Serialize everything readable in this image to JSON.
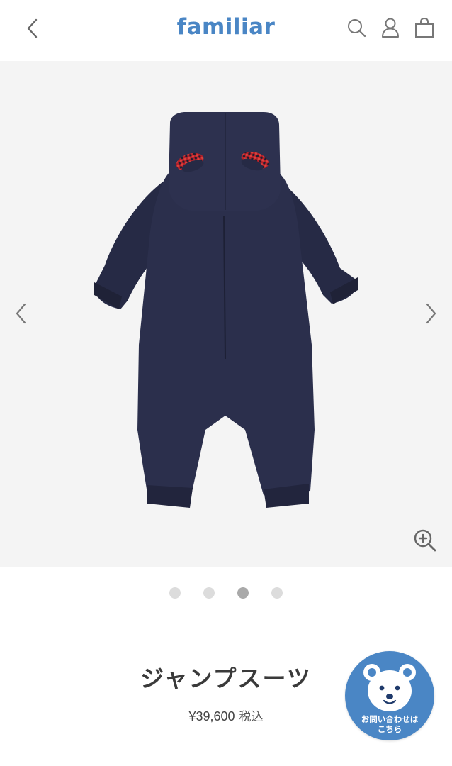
{
  "header": {
    "logo": "familiar",
    "icons": [
      "back-chevron-icon",
      "search-icon",
      "account-icon",
      "cart-bag-icon"
    ]
  },
  "gallery": {
    "slide_count": 4,
    "active_slide": 3,
    "icons": [
      "chevron-left-icon",
      "chevron-right-icon",
      "zoom-in-icon"
    ]
  },
  "product": {
    "name": "ジャンプスーツ",
    "price": "¥39,600",
    "tax_label": "税込"
  },
  "contact": {
    "line1": "お問い合わせは",
    "line2": "こちら",
    "icon": "bear-face-icon"
  },
  "colors": {
    "brand_blue": "#4a86c5",
    "garment_navy": "#262a45",
    "background_gray": "#f4f4f4"
  }
}
